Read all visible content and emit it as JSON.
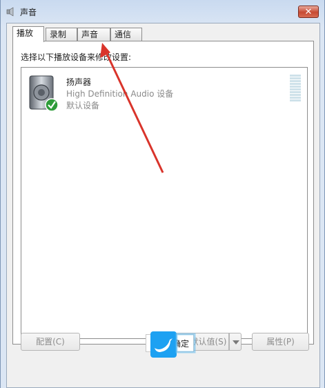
{
  "window": {
    "title": "声音",
    "close_label": "✕"
  },
  "tabs": [
    {
      "label": "播放",
      "active": true
    },
    {
      "label": "录制",
      "active": false
    },
    {
      "label": "声音",
      "active": false
    },
    {
      "label": "通信",
      "active": false
    }
  ],
  "panel": {
    "instruction": "选择以下播放设备来修改设置:",
    "device": {
      "name": "扬声器",
      "description": "High Definition Audio 设备",
      "status": "默认设备",
      "icon": "speaker-icon",
      "badge": "check-icon"
    }
  },
  "buttons": {
    "configure": "配置(C)",
    "set_default": "设为默认值(S)",
    "properties": "属性(P)",
    "ok": "确定"
  },
  "colors": {
    "accent_arrow": "#d9342b",
    "check_green": "#2e9c3a"
  }
}
